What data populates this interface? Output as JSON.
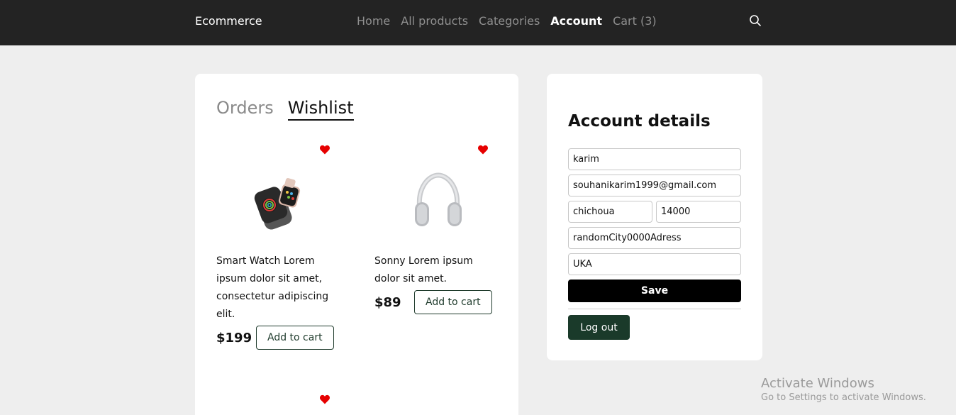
{
  "header": {
    "brand": "Ecommerce",
    "nav": {
      "home": "Home",
      "all_products": "All products",
      "categories": "Categories",
      "account": "Account",
      "cart": "Cart (3)"
    },
    "search_icon": "search-icon"
  },
  "tabs": {
    "orders": "Orders",
    "wishlist": "Wishlist",
    "active": "Wishlist"
  },
  "wishlist": [
    {
      "description": "Smart Watch Lorem ipsum dolor sit amet, consectetur adipiscing elit.",
      "price": "$199",
      "button": "Add to cart",
      "image": "smart-watch-image"
    },
    {
      "description": "Sonny Lorem ipsum dolor sit amet.",
      "price": "$89",
      "button": "Add to cart",
      "image": "headphones-image"
    }
  ],
  "account": {
    "title": "Account details",
    "fields": {
      "name": "karim",
      "email": "souhanikarim1999@gmail.com",
      "city": "chichoua",
      "zip": "14000",
      "address": "randomCity0000Adress",
      "country": "UKA"
    },
    "save": "Save",
    "logout": "Log out"
  },
  "colors": {
    "navbar": "#232323",
    "heart": "#e60000",
    "logout": "#1a3a2a"
  },
  "watermark": {
    "title": "Activate Windows",
    "subtitle": "Go to Settings to activate Windows."
  }
}
